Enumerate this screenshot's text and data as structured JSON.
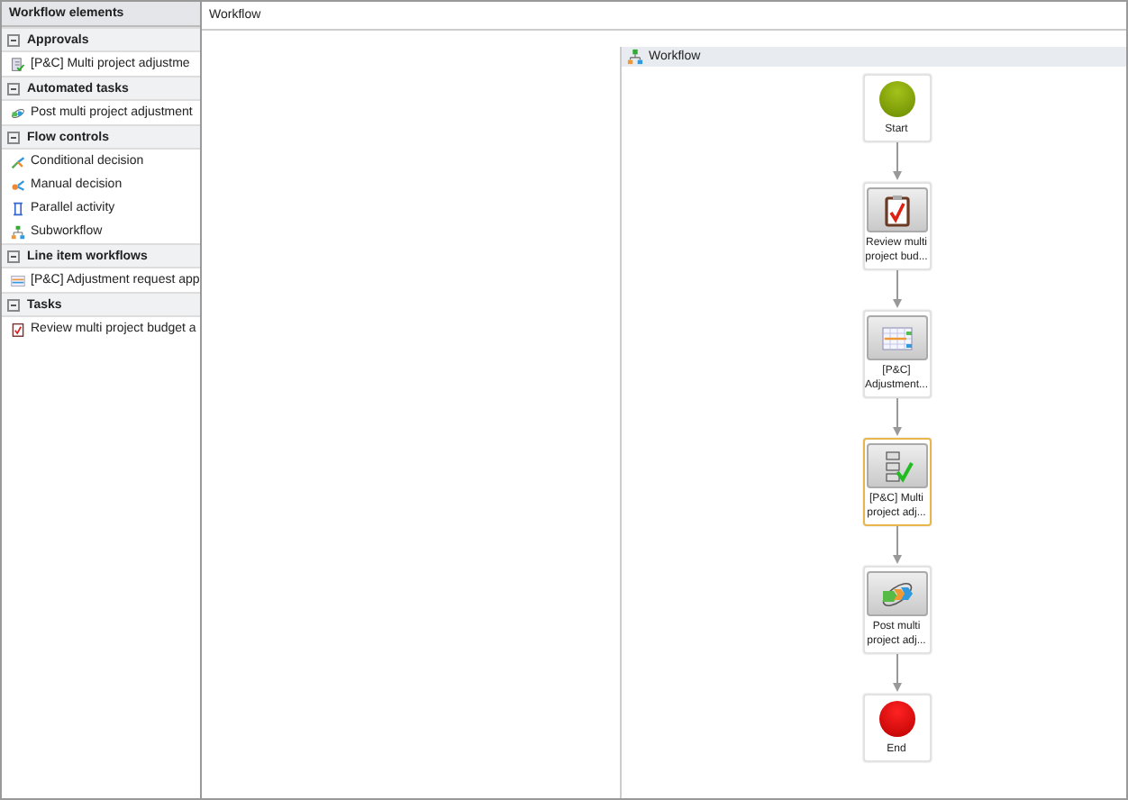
{
  "sidebar": {
    "title": "Workflow elements",
    "groups": [
      {
        "label": "Approvals",
        "expanded": true,
        "items": [
          {
            "kind": "approval",
            "label": "[P&C] Multi project adjustme"
          }
        ]
      },
      {
        "label": "Automated tasks",
        "expanded": true,
        "items": [
          {
            "kind": "automated",
            "label": "Post multi project adjustment"
          }
        ]
      },
      {
        "label": "Flow controls",
        "expanded": true,
        "items": [
          {
            "kind": "conditional",
            "label": "Conditional decision"
          },
          {
            "kind": "manual",
            "label": "Manual decision"
          },
          {
            "kind": "parallel",
            "label": "Parallel activity"
          },
          {
            "kind": "subworkflow",
            "label": "Subworkflow"
          }
        ]
      },
      {
        "label": "Line item workflows",
        "expanded": true,
        "items": [
          {
            "kind": "lineitem",
            "label": "[P&C] Adjustment request app"
          }
        ]
      },
      {
        "label": "Tasks",
        "expanded": true,
        "items": [
          {
            "kind": "task",
            "label": "Review multi project budget a"
          }
        ]
      }
    ]
  },
  "tab": {
    "title": "Workflow"
  },
  "designer": {
    "title": "Workflow",
    "nodes": [
      {
        "kind": "start",
        "label": "Start",
        "selected": false
      },
      {
        "kind": "task",
        "label": "Review multi project bud...",
        "selected": false
      },
      {
        "kind": "lineitem",
        "label": "[P&C] Adjustment...",
        "selected": false
      },
      {
        "kind": "approval",
        "label": "[P&C] Multi project adj...",
        "selected": true
      },
      {
        "kind": "automated",
        "label": "Post multi project adj...",
        "selected": false
      },
      {
        "kind": "end",
        "label": "End",
        "selected": false
      }
    ]
  }
}
